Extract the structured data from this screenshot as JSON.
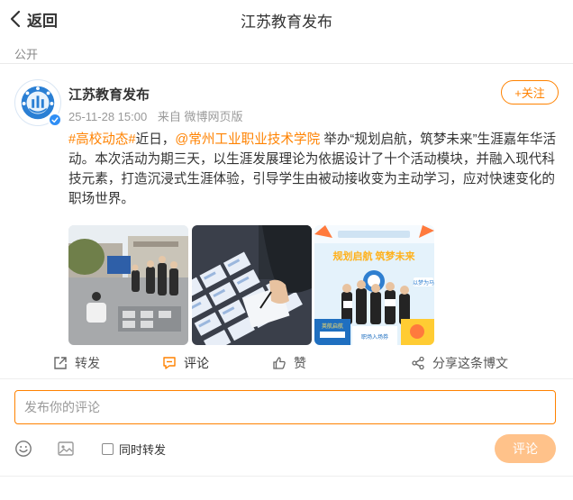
{
  "header": {
    "back_label": "返回",
    "title": "江苏教育发布"
  },
  "visibility": "公开",
  "post": {
    "author": "江苏教育发布",
    "timestamp": "25-11-28 15:00",
    "source_prefix": "来自",
    "source": "微博网页版",
    "follow_label": "+关注",
    "text": {
      "tag": "#高校动态#",
      "lead": "近日，",
      "mention": "@常州工业职业技术学院",
      "body": " 举办“规划启航，筑梦未来”生涯嘉年华活动。本次活动为期三天，以生涯发展理论为依据设计了十个活动模块，并融入现代科技元素，打造沉浸式生涯体验，引导学生由被动接收变为主动学习，应对快速变化的职场世界。"
    },
    "image3_texts": {
      "banner": "规划启航 筑梦未来",
      "tag": "以梦为马",
      "panel": "英航启航",
      "sub": "职场入场券"
    },
    "actions": {
      "repost": "转发",
      "comment": "评论",
      "like": "赞",
      "share": "分享这条博文"
    }
  },
  "composer": {
    "placeholder": "发布你的评论",
    "repost_option": "同时转发",
    "submit_label": "评论"
  },
  "colors": {
    "accent": "#ff8200",
    "submit_disabled": "#ffc28a",
    "verify_badge": "#2f8ef5"
  },
  "icons": {
    "back": "chevron-left-icon",
    "repost": "repost-icon",
    "comment": "comment-icon",
    "like": "thumb-up-icon",
    "share": "share-icon",
    "emoji": "emoji-icon",
    "image": "image-icon"
  }
}
